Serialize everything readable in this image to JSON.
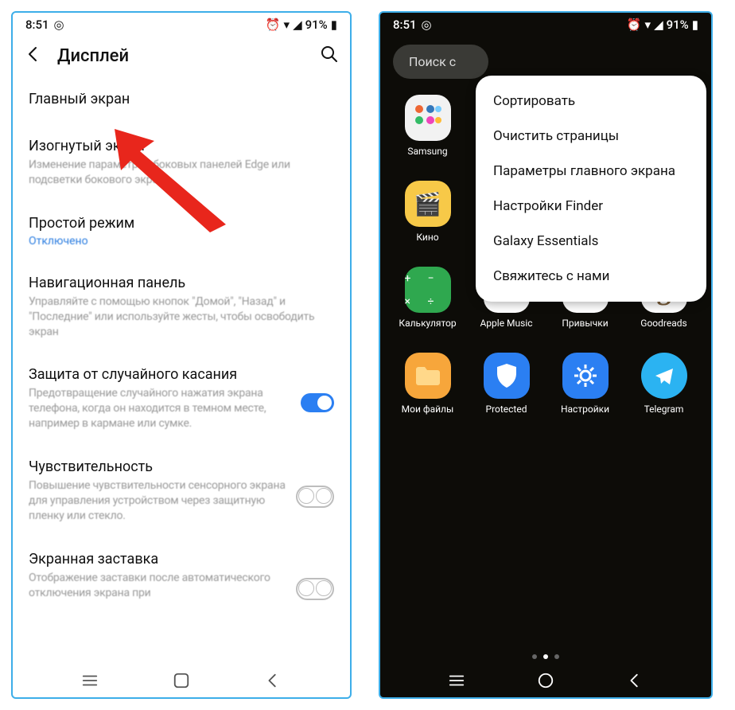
{
  "left": {
    "status": {
      "time": "8:51",
      "battery": "91%"
    },
    "header": {
      "title": "Дисплей"
    },
    "items": [
      {
        "title": "Главный экран",
        "sub": ""
      },
      {
        "title": "Изогнутый экран",
        "sub": "Изменение параметров боковых панелей Edge или подсветки бокового экрана"
      },
      {
        "title": "Простой режим",
        "status": "Отключено"
      },
      {
        "title": "Навигационная панель",
        "sub": "Управляйте с помощью кнопок \"Домой\", \"Назад\" и \"Последние\" или используйте жесты, чтобы освободить экран"
      },
      {
        "title": "Защита от случайного касания",
        "sub": "Предотвращение случайного нажатия экрана телефона, когда он находится в темном месте, например в кармане или сумке."
      },
      {
        "title": "Чувствительность",
        "sub": "Повышение чувствительности сенсорного экрана для управления устройством через защитную пленку или стекло."
      },
      {
        "title": "Экранная заставка",
        "sub": "Отображение заставки после автоматического отключения экрана при"
      }
    ]
  },
  "right": {
    "status": {
      "time": "8:51",
      "battery": "91%"
    },
    "search": {
      "placeholder": "Поиск с"
    },
    "menu": {
      "items": [
        {
          "label": "Сортировать"
        },
        {
          "label": "Очистить страницы"
        },
        {
          "label": "Параметры главного экрана"
        },
        {
          "label": "Настройки Finder"
        },
        {
          "label": "Galaxy Essentials"
        },
        {
          "label": "Свяжитесь с нами"
        }
      ]
    },
    "apps": [
      [
        {
          "label": "Samsung",
          "icon": "samsung",
          "bg": "#f2f2f2"
        }
      ],
      [
        {
          "label": "Кино",
          "icon": "kino",
          "bg": "#f7c948"
        }
      ],
      [
        {
          "label": "Калькулятор",
          "icon": "calc",
          "bg": "#2fa84f"
        },
        {
          "label": "Apple Music",
          "icon": "music",
          "bg": "#fff"
        },
        {
          "label": "Привычки",
          "icon": "habits",
          "bg": "#fff"
        },
        {
          "label": "Goodreads",
          "icon": "goodreads",
          "bg": "#fff"
        }
      ],
      [
        {
          "label": "Мои файлы",
          "icon": "files",
          "bg": "#f7a63b"
        },
        {
          "label": "Protected",
          "icon": "protected",
          "bg": "#2b7ff2"
        },
        {
          "label": "Настройки",
          "icon": "settings",
          "bg": "#2b7ff2"
        },
        {
          "label": "Telegram",
          "icon": "telegram",
          "bg": "#2bb3f2"
        }
      ]
    ]
  }
}
